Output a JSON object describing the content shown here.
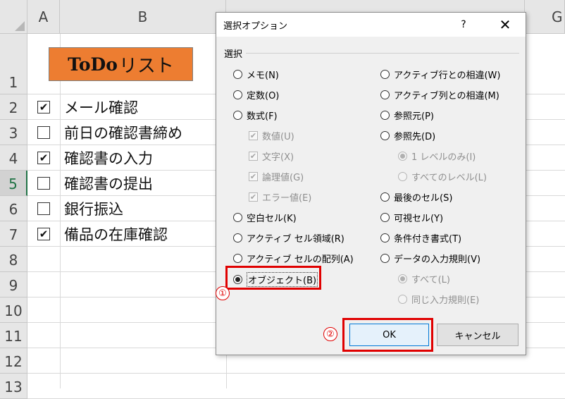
{
  "sheet": {
    "columns": [
      {
        "id": "A",
        "label": "A"
      },
      {
        "id": "B",
        "label": "B"
      },
      {
        "id": "G",
        "label": "G"
      }
    ],
    "rows": [
      "1",
      "2",
      "3",
      "4",
      "5",
      "6",
      "7",
      "8",
      "9",
      "10",
      "11",
      "12",
      "13"
    ],
    "selected_row": "5",
    "title_bold": "ToDo",
    "title_rest": "リスト",
    "tasks": [
      {
        "checked": true,
        "text": "メール確認"
      },
      {
        "checked": false,
        "text": "前日の確認書締め"
      },
      {
        "checked": true,
        "text": "確認書の入力"
      },
      {
        "checked": false,
        "text": "確認書の提出"
      },
      {
        "checked": false,
        "text": "銀行振込"
      },
      {
        "checked": true,
        "text": "備品の在庫確認"
      }
    ],
    "check_glyph": "✔",
    "title_fill_color": "#ed7d31"
  },
  "dialog": {
    "title": "選択オプション",
    "help_label": "?",
    "close_label": "✕",
    "group_label": "選択",
    "left_options": [
      {
        "label": "メモ(N)",
        "state": "radio"
      },
      {
        "label": "定数(O)",
        "state": "radio"
      },
      {
        "label": "数式(F)",
        "state": "radio"
      },
      {
        "label": "数値(U)",
        "state": "sub-check"
      },
      {
        "label": "文字(X)",
        "state": "sub-check"
      },
      {
        "label": "論理値(G)",
        "state": "sub-check"
      },
      {
        "label": "エラー値(E)",
        "state": "sub-check"
      },
      {
        "label": "空白セル(K)",
        "state": "radio"
      },
      {
        "label": "アクティブ セル領域(R)",
        "state": "radio"
      },
      {
        "label": "アクティブ セルの配列(A)",
        "state": "radio"
      },
      {
        "label": "オブジェクト(B)",
        "state": "radio-selected"
      }
    ],
    "right_options": [
      {
        "label": "アクティブ行との相違(W)",
        "state": "radio"
      },
      {
        "label": "アクティブ列との相違(M)",
        "state": "radio"
      },
      {
        "label": "参照元(P)",
        "state": "radio"
      },
      {
        "label": "参照先(D)",
        "state": "radio"
      },
      {
        "label": "1 レベルのみ(I)",
        "state": "sub-radio-selected"
      },
      {
        "label": "すべてのレベル(L)",
        "state": "sub-radio"
      },
      {
        "label": "最後のセル(S)",
        "state": "radio"
      },
      {
        "label": "可視セル(Y)",
        "state": "radio"
      },
      {
        "label": "条件付き書式(T)",
        "state": "radio"
      },
      {
        "label": "データの入力規則(V)",
        "state": "radio"
      },
      {
        "label": "すべて(L)",
        "state": "sub-radio-selected"
      },
      {
        "label": "同じ入力規則(E)",
        "state": "sub-radio"
      }
    ],
    "ok_label": "OK",
    "cancel_label": "キャンセル"
  },
  "annotations": {
    "step1": "①",
    "step2": "②",
    "highlight_color": "#e00000"
  }
}
